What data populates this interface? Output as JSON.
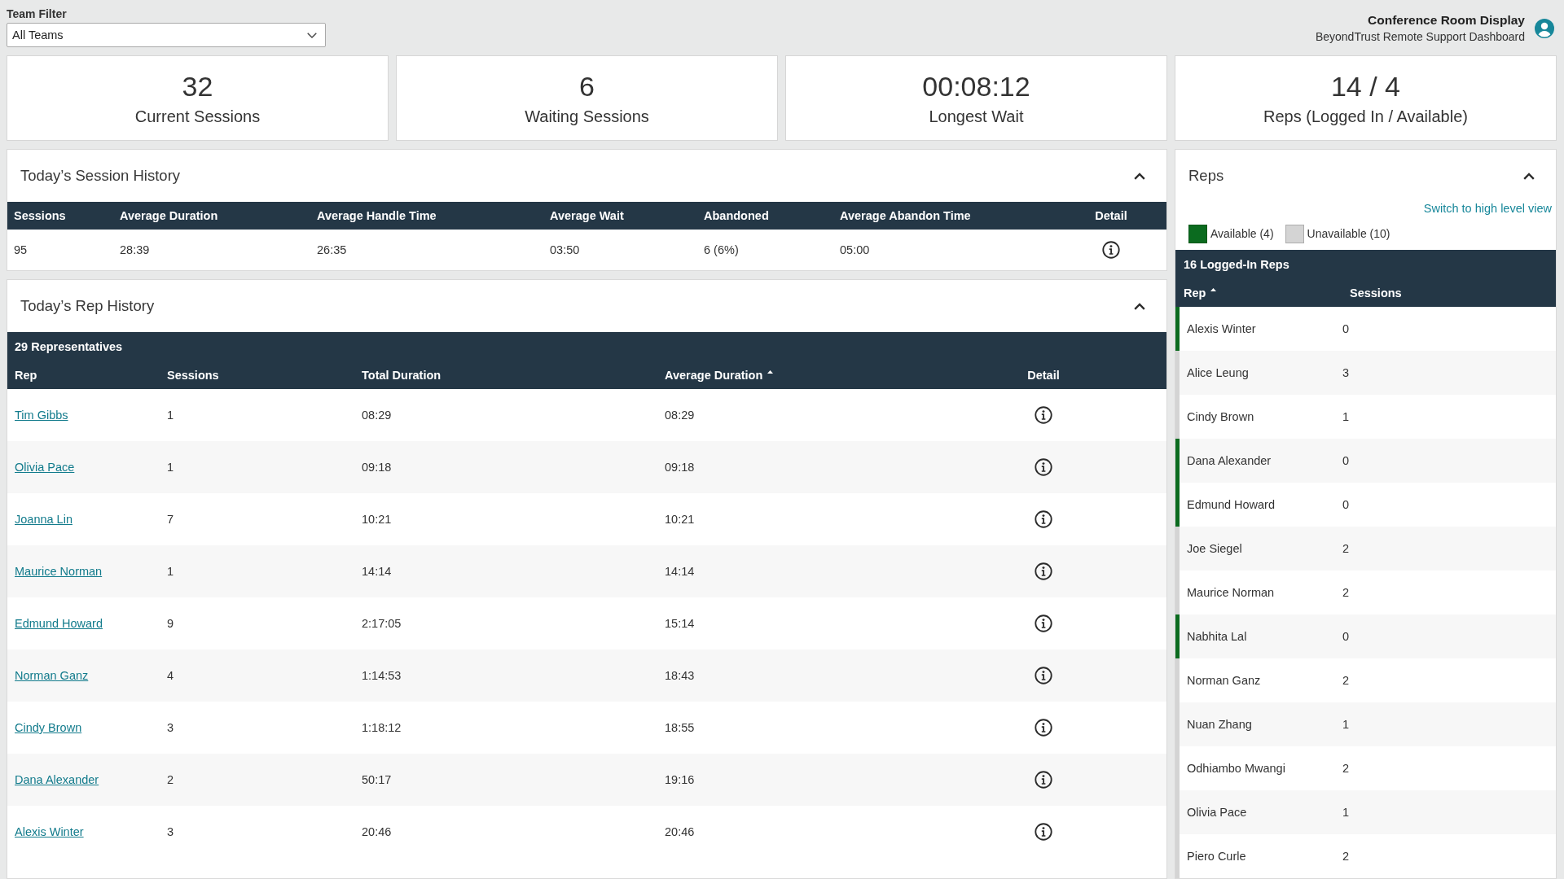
{
  "header": {
    "filter": {
      "label": "Team Filter",
      "value": "All Teams"
    },
    "display": {
      "title": "Conference Room Display",
      "subtitle": "BeyondTrust Remote Support Dashboard"
    }
  },
  "stats": [
    {
      "value": "32",
      "label": "Current Sessions"
    },
    {
      "value": "6",
      "label": "Waiting Sessions"
    },
    {
      "value": "00:08:12",
      "label": "Longest Wait"
    },
    {
      "value": "14 / 4",
      "label": "Reps (Logged In / Available)"
    }
  ],
  "session_history": {
    "title": "Today’s Session History",
    "expanded": true,
    "columns": [
      {
        "label": "Sessions",
        "kind": "text"
      },
      {
        "label": "Average Duration",
        "kind": "text"
      },
      {
        "label": "Average Handle Time",
        "kind": "text"
      },
      {
        "label": "Average Wait",
        "kind": "text"
      },
      {
        "label": "Abandoned",
        "kind": "text"
      },
      {
        "label": "Average Abandon Time",
        "kind": "text"
      },
      {
        "label": "Detail",
        "kind": "detail"
      }
    ],
    "rows": [
      [
        "95",
        "28:39",
        "26:35",
        "03:50",
        "6 (6%)",
        "05:00"
      ]
    ]
  },
  "rep_history": {
    "title": "Today’s Rep History",
    "expanded": true,
    "count_label": "29 Representatives",
    "columns": [
      {
        "label": "Rep",
        "kind": "link",
        "sorted": false
      },
      {
        "label": "Sessions",
        "kind": "text",
        "sorted": false
      },
      {
        "label": "Total Duration",
        "kind": "text",
        "sorted": false
      },
      {
        "label": "Average Duration",
        "kind": "text",
        "sorted": true
      },
      {
        "label": "Detail",
        "kind": "detail",
        "sorted": false
      }
    ],
    "rows": [
      [
        "Tim Gibbs",
        "1",
        "08:29",
        "08:29"
      ],
      [
        "Olivia Pace",
        "1",
        "09:18",
        "09:18"
      ],
      [
        "Joanna Lin",
        "7",
        "10:21",
        "10:21"
      ],
      [
        "Maurice Norman",
        "1",
        "14:14",
        "14:14"
      ],
      [
        "Edmund Howard",
        "9",
        "2:17:05",
        "15:14"
      ],
      [
        "Norman Ganz",
        "4",
        "1:14:53",
        "18:43"
      ],
      [
        "Cindy Brown",
        "3",
        "1:18:12",
        "18:55"
      ],
      [
        "Dana Alexander",
        "2",
        "50:17",
        "19:16"
      ],
      [
        "Alexis Winter",
        "3",
        "20:46",
        "20:46"
      ]
    ]
  },
  "reps": {
    "title": "Reps",
    "expanded": true,
    "switch_link": "Switch to high level view",
    "legend": [
      {
        "label": "Available (4)",
        "color": "#0b6b1f"
      },
      {
        "label": "Unavailable (10)",
        "color": "#d4d4d4"
      }
    ],
    "count_label": "16 Logged-In Reps",
    "columns": [
      {
        "label": "Rep",
        "sorted": true
      },
      {
        "label": "Sessions",
        "sorted": false
      }
    ],
    "rows": [
      {
        "name": "Alexis Winter",
        "sessions": "0",
        "color": "#0b6b1f"
      },
      {
        "name": "Alice Leung",
        "sessions": "3",
        "color": "#d4d4d4"
      },
      {
        "name": "Cindy Brown",
        "sessions": "1",
        "color": "#d4d4d4"
      },
      {
        "name": "Dana Alexander",
        "sessions": "0",
        "color": "#0b6b1f"
      },
      {
        "name": "Edmund Howard",
        "sessions": "0",
        "color": "#0b6b1f"
      },
      {
        "name": "Joe Siegel",
        "sessions": "2",
        "color": "#d4d4d4"
      },
      {
        "name": "Maurice Norman",
        "sessions": "2",
        "color": "#d4d4d4"
      },
      {
        "name": "Nabhita Lal",
        "sessions": "0",
        "color": "#0b6b1f"
      },
      {
        "name": "Norman Ganz",
        "sessions": "2",
        "color": "#d4d4d4"
      },
      {
        "name": "Nuan Zhang",
        "sessions": "1",
        "color": "#d4d4d4"
      },
      {
        "name": "Odhiambo Mwangi",
        "sessions": "2",
        "color": "#d4d4d4"
      },
      {
        "name": "Olivia Pace",
        "sessions": "1",
        "color": "#d4d4d4"
      },
      {
        "name": "Piero Curle",
        "sessions": "2",
        "color": "#d4d4d4"
      }
    ]
  }
}
